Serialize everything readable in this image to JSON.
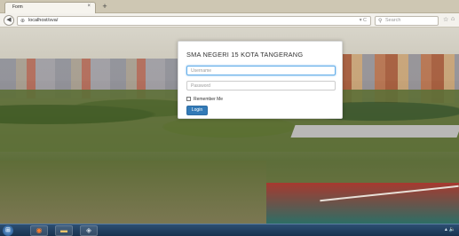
{
  "browser": {
    "tab_title": "Form",
    "tab_close": "×",
    "new_tab": "+",
    "url": "localhost/sva/",
    "url_tools": "▾ C",
    "search_placeholder": "Search",
    "back_glyph": "◀",
    "icons": {
      "back": "back-arrow-icon",
      "globe": "globe-icon",
      "search": "search-icon",
      "bookmark": "star-icon",
      "home": "home-icon"
    }
  },
  "login": {
    "title": "SMA NEGERI 15 KOTA TANGERANG",
    "username_placeholder": "Username",
    "password_placeholder": "Password",
    "remember_label": "Remember Me",
    "login_button": "Login"
  },
  "taskbar": {
    "start_glyph": "⊞",
    "items": [
      {
        "name": "firefox-icon",
        "glyph": "◉"
      },
      {
        "name": "folder-icon",
        "glyph": "▬"
      },
      {
        "name": "app-icon",
        "glyph": "◈"
      }
    ],
    "tray": "▴ 🔈"
  },
  "colors": {
    "accent": "#337ab7",
    "focus": "#66afe9"
  }
}
